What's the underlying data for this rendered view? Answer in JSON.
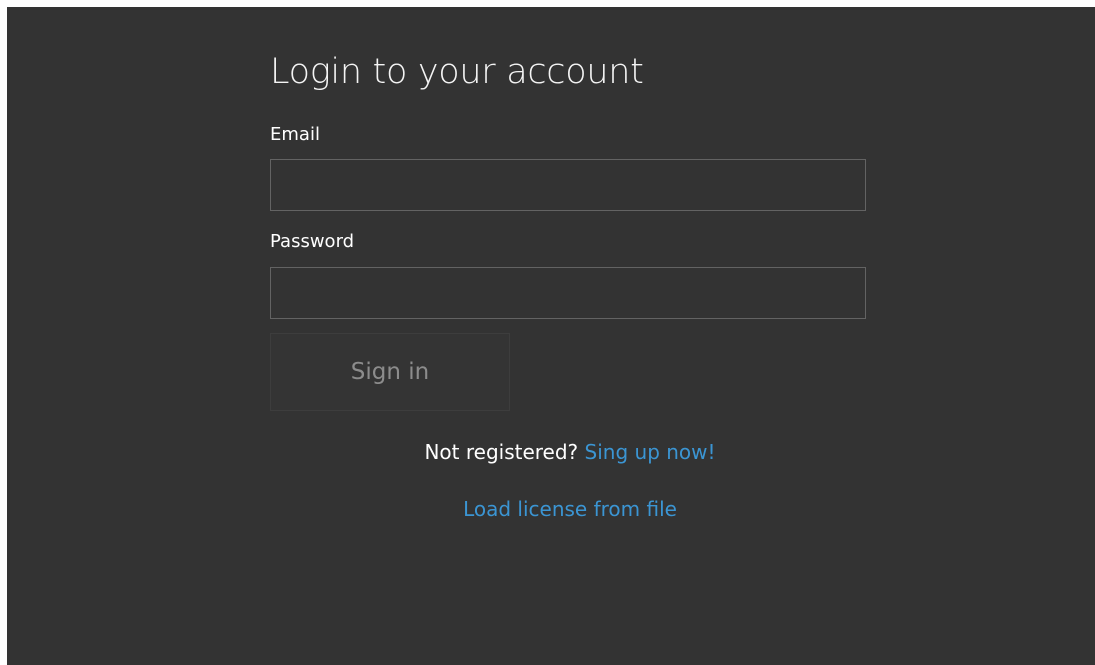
{
  "login": {
    "title": "Login to your account",
    "email_label": "Email",
    "email_value": "",
    "password_label": "Password",
    "password_value": "",
    "signin_label": "Sign in",
    "not_registered_text": "Not registered?",
    "signup_link": "Sing up now!",
    "load_license_link": "Load license from file"
  },
  "colors": {
    "background": "#333333",
    "link": "#3b95d3",
    "input_border": "#636363",
    "disabled_text": "#8c8c8c"
  }
}
